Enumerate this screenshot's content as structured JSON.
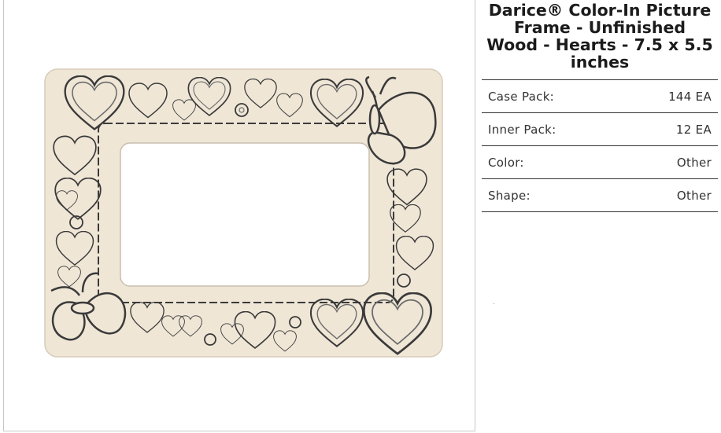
{
  "product": {
    "title": "Darice® Color-In Picture Frame - Unfinished Wood - Hearts - 7.5 x 5.5 inches",
    "image_alt": "Unfinished wood picture frame with heart and butterfly line drawings"
  },
  "specs": [
    {
      "label": "Case Pack:",
      "value": "144 EA"
    },
    {
      "label": "Inner Pack:",
      "value": "12 EA"
    },
    {
      "label": "Color:",
      "value": "Other"
    },
    {
      "label": "Shape:",
      "value": "Other"
    }
  ],
  "colors": {
    "frame_fill": "#efe6d6",
    "line": "#3a3a3a",
    "border": "#333333"
  }
}
